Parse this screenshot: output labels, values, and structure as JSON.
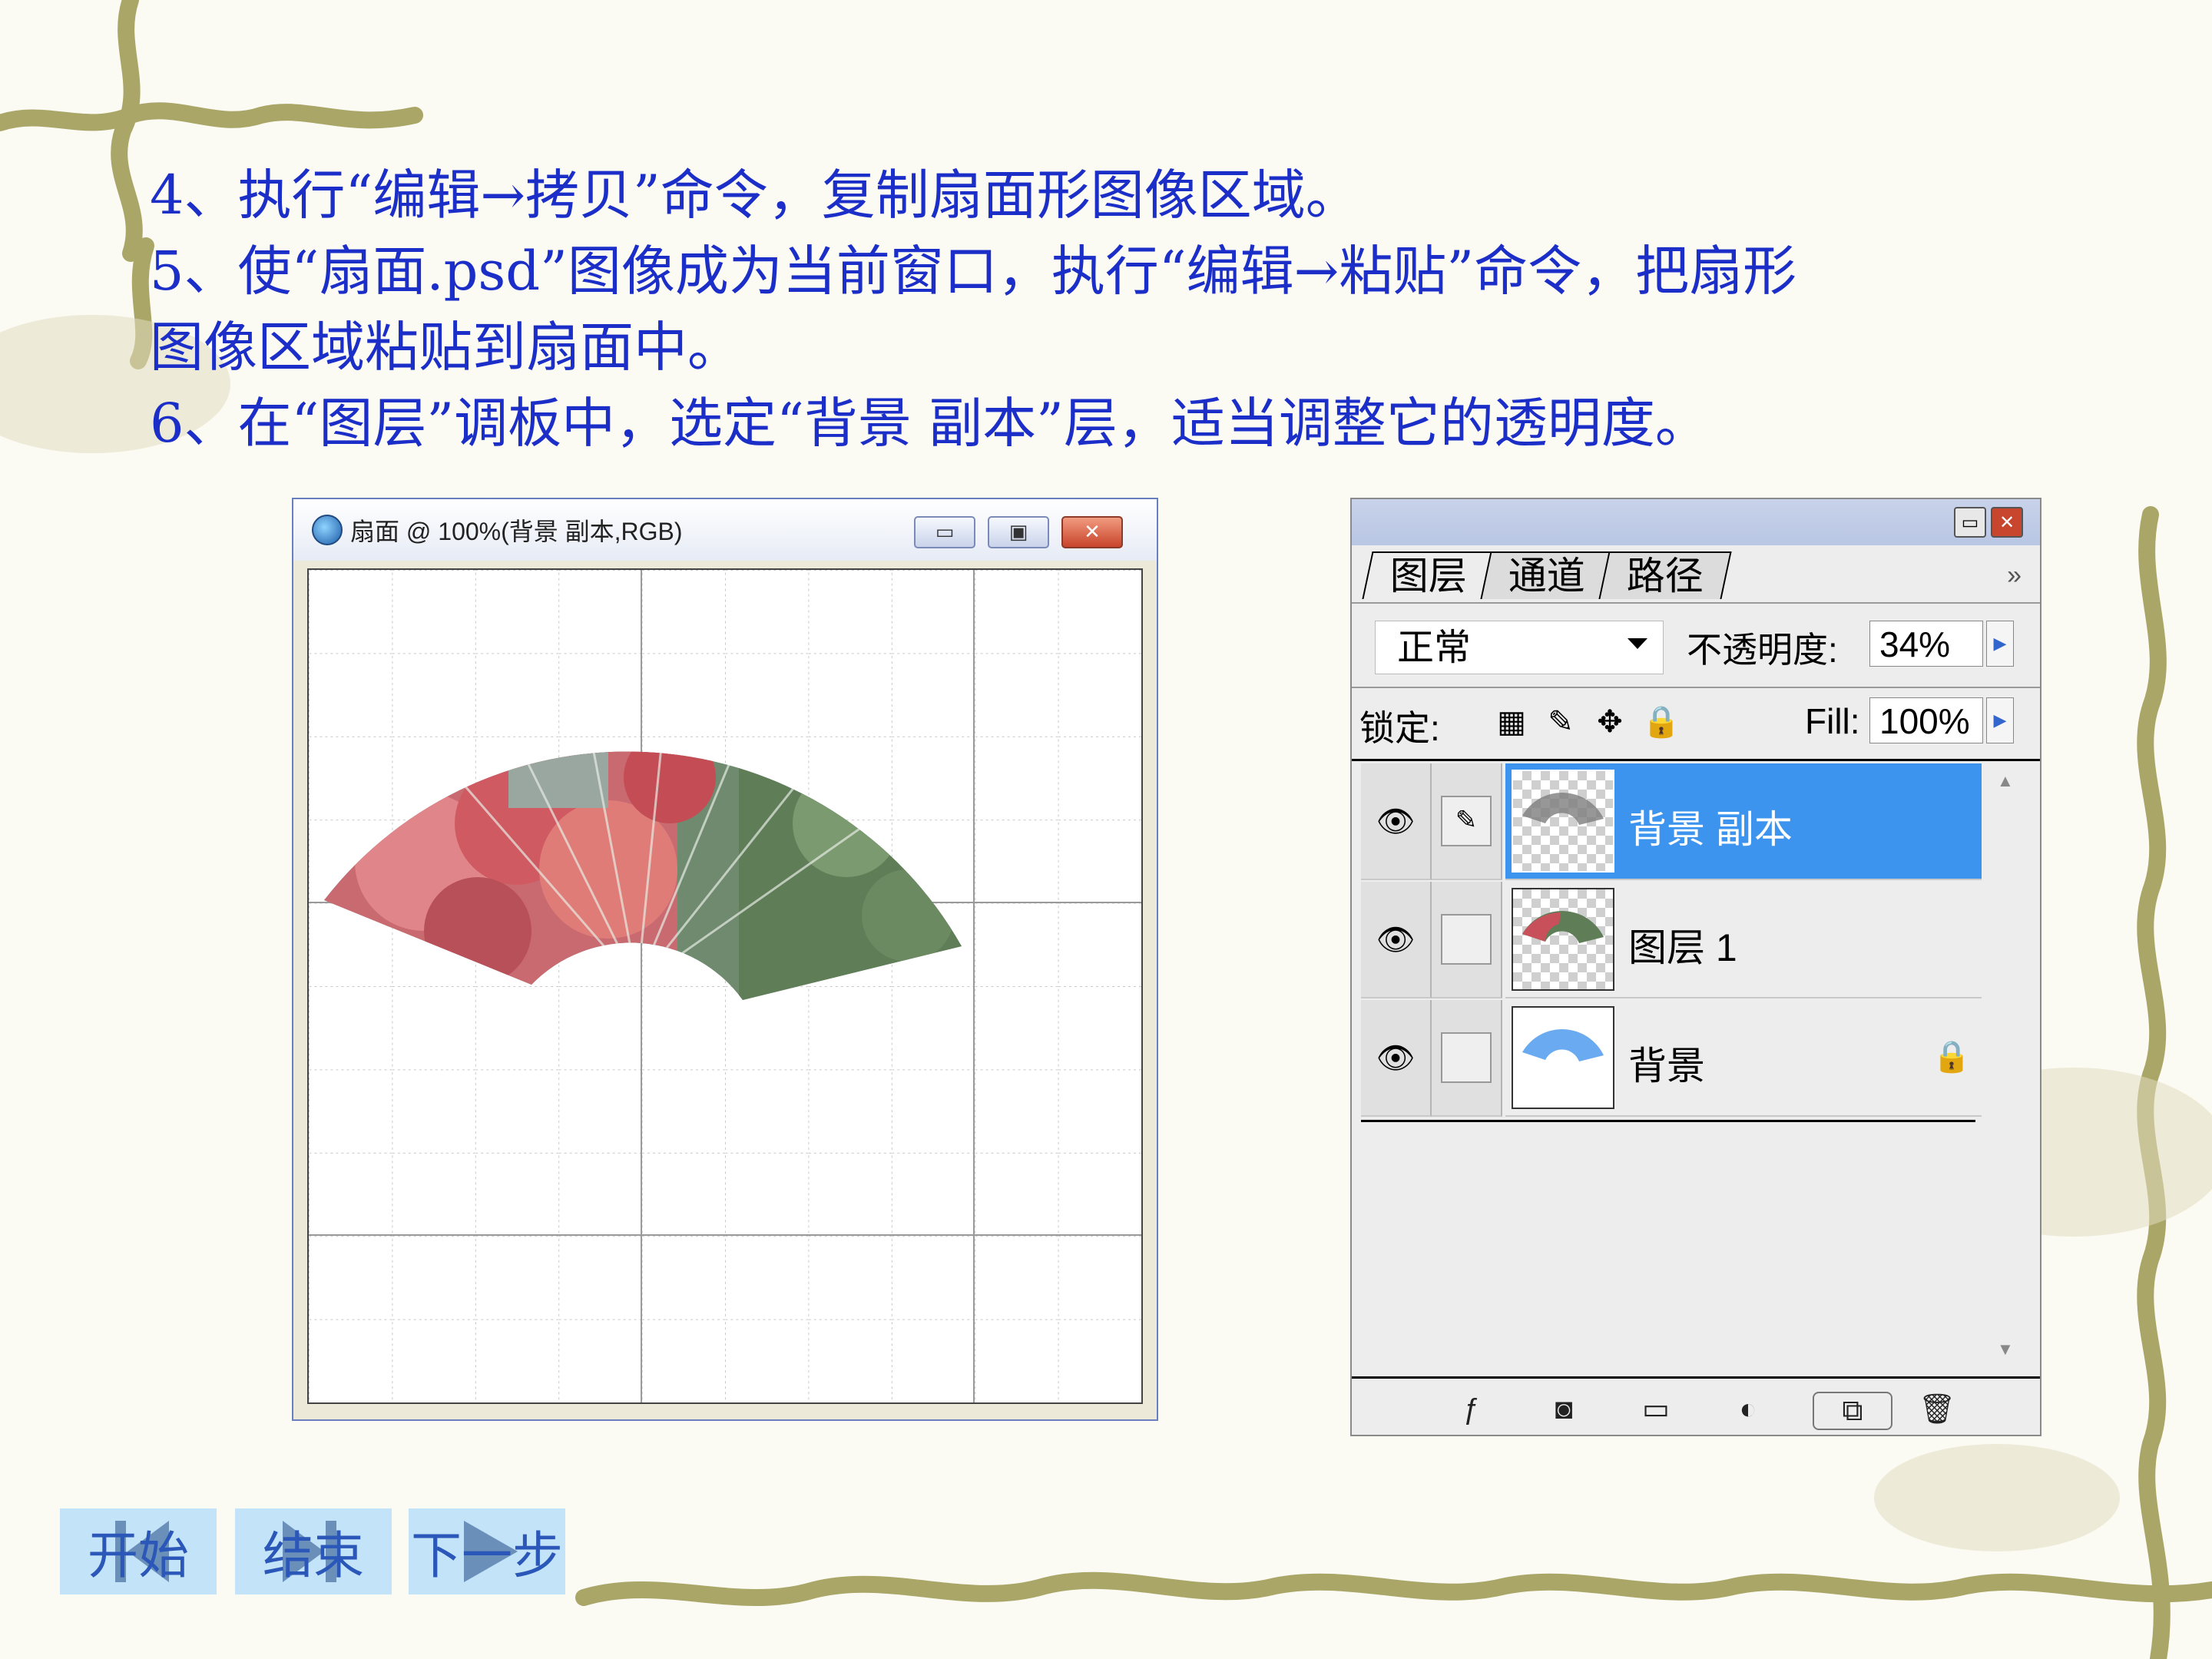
{
  "instructions": {
    "line1": "4、执行“编辑→拷贝”命令，复制扇面形图像区域。",
    "line2": "5、使“扇面.psd”图像成为当前窗口，执行“编辑→粘贴”命令，把扇形",
    "line3": "图像区域粘贴到扇面中。",
    "line4": "6、在“图层”调板中，选定“背景  副本”层，适当调整它的透明度。"
  },
  "document_window": {
    "title": "扇面 @ 100%(背景 副本,RGB)",
    "minimize_glyph": "▭",
    "maximize_glyph": "▣",
    "close_glyph": "✕"
  },
  "layers_palette": {
    "window_buttons": {
      "minimize_glyph": "▭",
      "close_glyph": "✕"
    },
    "tabs": [
      "图层",
      "通道",
      "路径"
    ],
    "more_glyph": "»",
    "blend_mode": "正常",
    "opacity_label": "不透明度:",
    "opacity_value": "34%",
    "lock_label": "锁定:",
    "fill_label": "Fill:",
    "fill_value": "100%",
    "layers": [
      {
        "name": "背景 副本",
        "selected": true,
        "locked": false,
        "thumbnail": "fan-gray"
      },
      {
        "name": "图层 1",
        "selected": false,
        "locked": false,
        "thumbnail": "fan-color"
      },
      {
        "name": "背景",
        "selected": false,
        "locked": true,
        "thumbnail": "fan-blue"
      }
    ],
    "footer_icons": [
      "layer-style-icon",
      "mask-icon",
      "folder-icon",
      "adjustment-icon",
      "new-layer-icon",
      "trash-icon"
    ],
    "colors": {
      "selection": "#3d94ee"
    }
  },
  "navigation": {
    "start": "开始",
    "end": "结束",
    "next": "下一步"
  },
  "colors": {
    "instruction_text": "#1b2fc8",
    "nav_button_bg": "#c3e3f8",
    "vine": "#a9a667"
  }
}
